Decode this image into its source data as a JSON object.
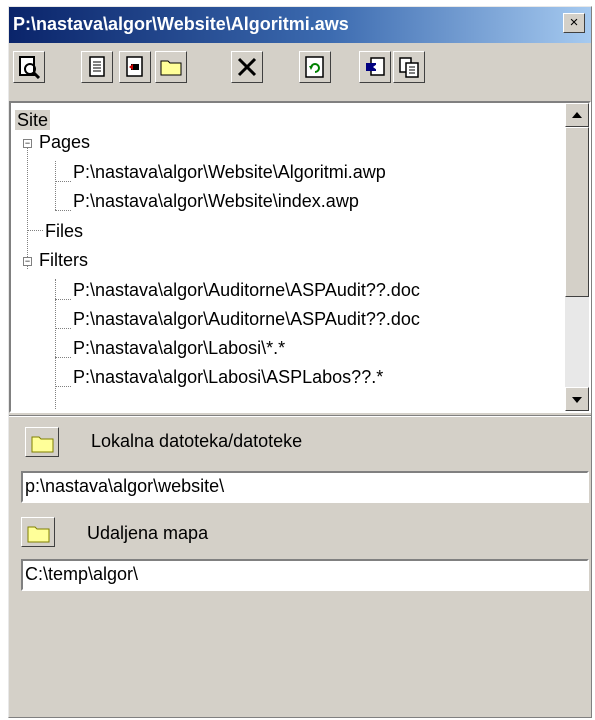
{
  "window": {
    "title": "P:\\nastava\\algor\\Website\\Algoritmi.aws",
    "close_label": "×"
  },
  "toolbar": {
    "buttons": [
      "preview-icon",
      "properties-icon",
      "publish-icon",
      "new-folder-icon",
      "delete-icon",
      "refresh-icon",
      "import-icon",
      "copy-icon"
    ]
  },
  "tree": {
    "site": "Site",
    "pages": {
      "label": "Pages",
      "items": [
        "P:\\nastava\\algor\\Website\\Algoritmi.awp",
        "P:\\nastava\\algor\\Website\\index.awp"
      ]
    },
    "files": "Files",
    "filters": {
      "label": "Filters",
      "items": [
        "P:\\nastava\\algor\\Auditorne\\ASPAudit??.doc",
        "P:\\nastava\\algor\\Auditorne\\ASPAudit??.doc",
        "P:\\nastava\\algor\\Labosi\\*.*",
        "P:\\nastava\\algor\\Labosi\\ASPLabos??.*"
      ]
    }
  },
  "local": {
    "label": "Lokalna datoteka/datoteke",
    "value": "p:\\nastava\\algor\\website\\"
  },
  "remote": {
    "label": "Udaljena mapa",
    "value": "C:\\temp\\algor\\"
  },
  "colors": {
    "titlebar": "#0a246a",
    "face": "#d4d0c8",
    "folder": "#ffff99"
  }
}
